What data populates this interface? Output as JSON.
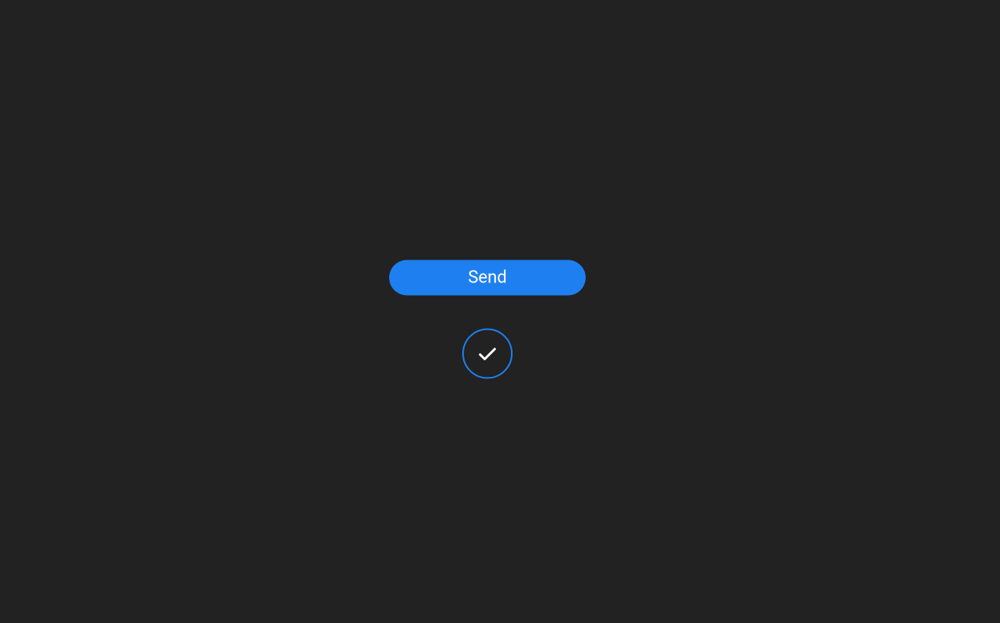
{
  "button": {
    "send_label": "Send"
  },
  "colors": {
    "accent": "#1E80F0",
    "background": "#222222",
    "text": "#ffffff"
  },
  "status": {
    "icon": "checkmark",
    "state": "success"
  }
}
